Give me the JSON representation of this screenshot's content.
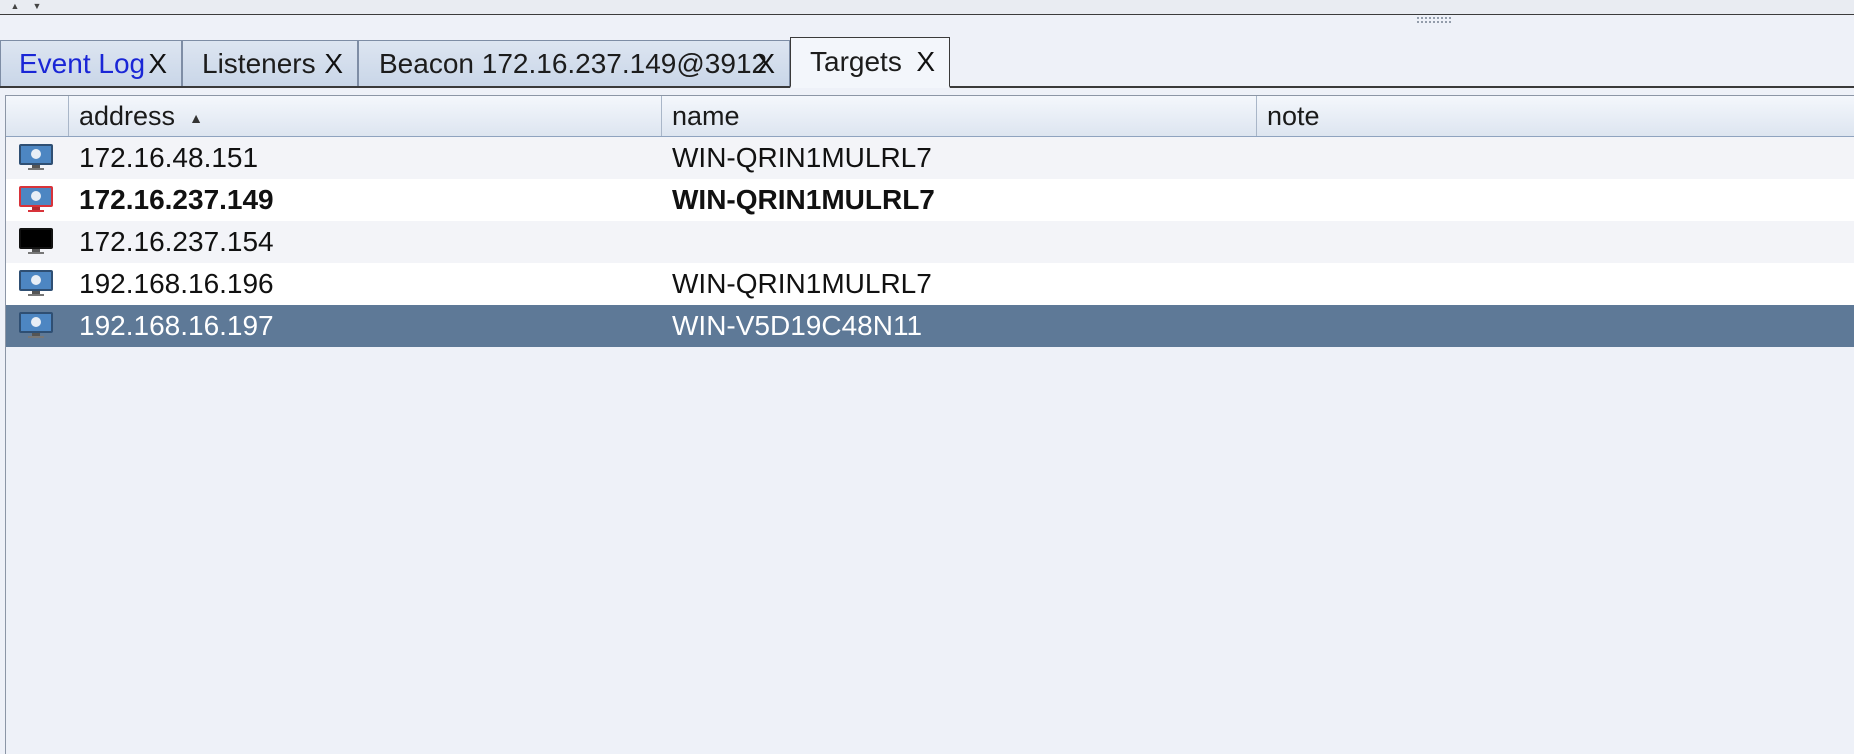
{
  "tabs": [
    {
      "label": "Event Log",
      "close": "X",
      "active": false
    },
    {
      "label": "Listeners",
      "close": "X",
      "active": false
    },
    {
      "label": "Beacon 172.16.237.149@3912",
      "close": "X",
      "active": false
    },
    {
      "label": "Targets",
      "close": "X",
      "active": true
    }
  ],
  "table": {
    "columns": {
      "icon": "",
      "address": "address",
      "name": "name",
      "note": "note"
    },
    "sort_indicator": "▲",
    "rows": [
      {
        "icon": "windows-monitor-icon",
        "address": "172.16.48.151",
        "name": "WIN-QRIN1MULRL7",
        "note": ""
      },
      {
        "icon": "windows-monitor-compromised-icon",
        "address": "172.16.237.149",
        "name": "WIN-QRIN1MULRL7",
        "note": ""
      },
      {
        "icon": "unknown-monitor-icon",
        "address": "172.16.237.154",
        "name": "",
        "note": ""
      },
      {
        "icon": "windows-monitor-icon",
        "address": "192.168.16.196",
        "name": "WIN-QRIN1MULRL7",
        "note": ""
      },
      {
        "icon": "windows-monitor-icon",
        "address": "192.168.16.197",
        "name": "WIN-V5D19C48N11",
        "note": ""
      }
    ]
  },
  "colors": {
    "selected_row": "#5e7997",
    "event_log_tab_text": "#1a26d6",
    "compromised_icon": "#d8333a"
  }
}
